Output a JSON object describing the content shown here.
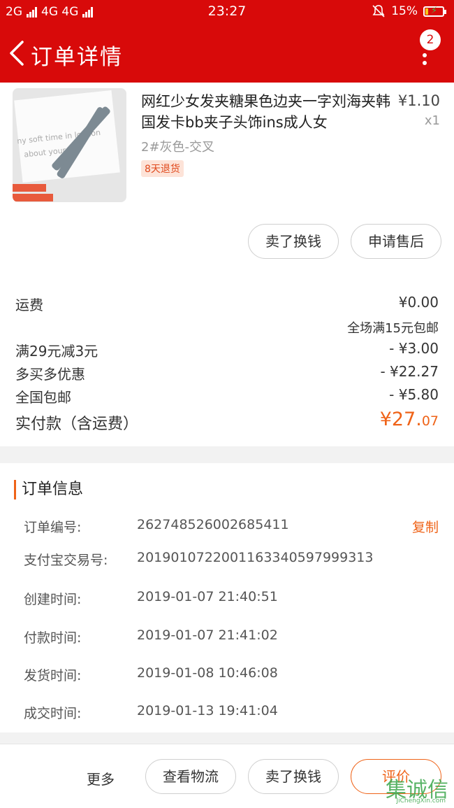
{
  "status_bar": {
    "network_1": "2G",
    "network_2": "4G 4G",
    "time": "23:27",
    "battery": "15%",
    "battery_level": 0.15
  },
  "header": {
    "title": "订单详情",
    "notification_count": "2"
  },
  "product": {
    "name": "网红少女发夹糖果色边夹一字刘海夹韩国发卡bb夹子头饰ins成人女",
    "price": "¥1.10",
    "quantity": "x1",
    "variant": "2#灰色-交叉",
    "badge": "8天退货",
    "thumb_text_1": "ny soft time in london",
    "thumb_text_2": "about yours?",
    "actions": [
      "卖了换钱",
      "申请售后"
    ]
  },
  "fees": {
    "shipping_label": "运费",
    "shipping_value": "¥0.00",
    "shipping_note": "全场满15元包邮",
    "rows": [
      {
        "label": "满29元减3元",
        "value": "- ¥3.00"
      },
      {
        "label": "多买多优惠",
        "value": "- ¥22.27"
      },
      {
        "label": "全国包邮",
        "value": "- ¥5.80"
      }
    ],
    "paid_label": "实付款（含运费）",
    "paid_major": "¥27.",
    "paid_minor": "07"
  },
  "order_info": {
    "heading": "订单信息",
    "copy_label": "复制",
    "rows": [
      {
        "label": "订单编号:",
        "value": "262748526002685411"
      },
      {
        "label": "支付宝交易号:",
        "value": "2019010722001163340597999313"
      },
      {
        "label": "创建时间:",
        "value": "2019-01-07 21:40:51"
      },
      {
        "label": "付款时间:",
        "value": "2019-01-07 21:41:02"
      },
      {
        "label": "发货时间:",
        "value": "2019-01-08 10:46:08"
      },
      {
        "label": "成交时间:",
        "value": "2019-01-13 19:41:04"
      }
    ]
  },
  "bottom_bar": {
    "more": "更多",
    "logistics": "查看物流",
    "resell": "卖了换钱",
    "review": "评价",
    "watermark": "集诚信",
    "watermark_url": "JiChengXin.com"
  },
  "colors": {
    "brand_red": "#d80a0a",
    "accent_orange": "#ef6318"
  }
}
